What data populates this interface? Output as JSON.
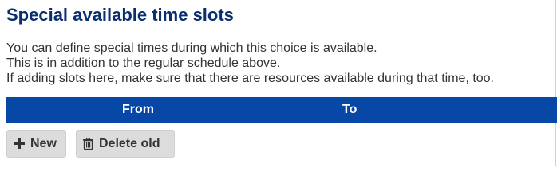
{
  "section": {
    "title": "Special available time slots",
    "description": [
      "You can define special times during which this choice is available.",
      "This is in addition to the regular schedule above.",
      "If adding slots here, make sure that there are resources available during that time, too."
    ]
  },
  "table": {
    "columns": [
      "From",
      "To"
    ],
    "header_color": "#0747a6"
  },
  "buttons": {
    "new": {
      "label": "New",
      "icon": "plus-icon"
    },
    "delete_old": {
      "label": "Delete old",
      "icon": "trash-icon"
    }
  },
  "colors": {
    "title": "#0a2f6e",
    "button_bg": "#dcdcdc",
    "text": "#333333"
  }
}
